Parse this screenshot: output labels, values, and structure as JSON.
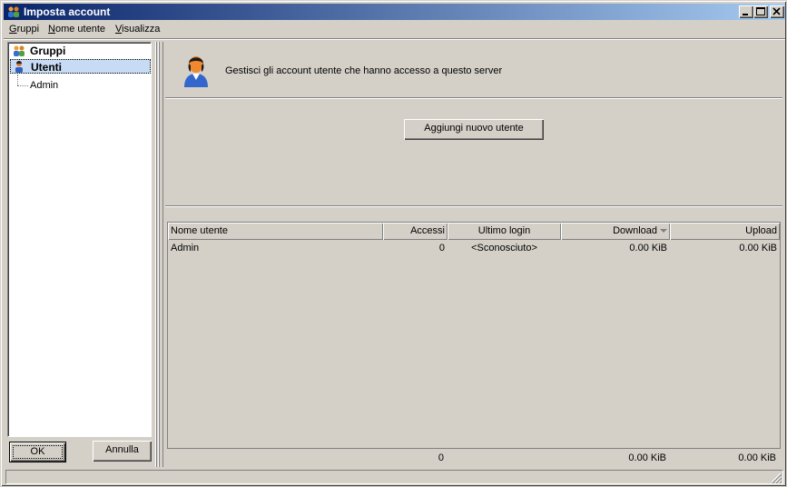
{
  "window": {
    "title": "Imposta account",
    "icon": "users-icon",
    "controls": [
      "minimize-icon",
      "maximize-icon",
      "close-icon"
    ]
  },
  "menu": {
    "items": [
      {
        "label": "Gruppi",
        "accel": "G",
        "rest": "ruppi"
      },
      {
        "label": "Nome utente",
        "accel": "N",
        "rest": "ome utente"
      },
      {
        "label": "Visualizza",
        "accel": "V",
        "rest": "isualizza"
      }
    ]
  },
  "tree": {
    "groups_label": "Gruppi",
    "users_label": "Utenti",
    "children": [
      "Admin"
    ]
  },
  "buttons": {
    "ok": "OK",
    "cancel": "Annulla",
    "add_user": "Aggiungi nuovo utente"
  },
  "panel": {
    "message": "Gestisci gli account utente che hanno accesso a questo server"
  },
  "table": {
    "columns": [
      "Nome utente",
      "Accessi",
      "Ultimo login",
      "Download",
      "Upload"
    ],
    "sorted_column": "Download",
    "rows": [
      {
        "name": "Admin",
        "accesses": "0",
        "last_login": "<Sconosciuto>",
        "download": "0.00 KiB",
        "upload": "0.00 KiB"
      }
    ],
    "totals": {
      "accesses": "0",
      "download": "0.00 KiB",
      "upload": "0.00 KiB"
    }
  }
}
